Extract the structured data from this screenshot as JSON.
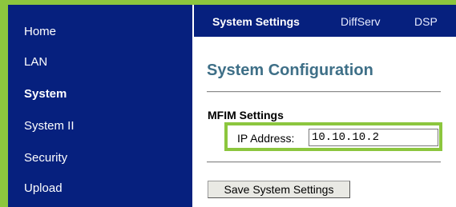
{
  "sidebar": {
    "items": [
      {
        "label": "Home"
      },
      {
        "label": "LAN"
      },
      {
        "label": "System",
        "active": true
      },
      {
        "label": "System II"
      },
      {
        "label": "Security"
      },
      {
        "label": "Upload"
      }
    ]
  },
  "topnav": {
    "tabs": [
      {
        "label": "System Settings",
        "active": true
      },
      {
        "label": "DiffServ"
      },
      {
        "label": "DSP"
      }
    ]
  },
  "main": {
    "title": "System Configuration",
    "section_title": "MFIM Settings",
    "ip_label": "IP Address:",
    "ip_value": "10.10.10.2",
    "save_button": "Save System Settings"
  },
  "colors": {
    "nav_bg": "#06207e",
    "highlight_green": "#8cc63e",
    "title_color": "#3e6f87"
  }
}
